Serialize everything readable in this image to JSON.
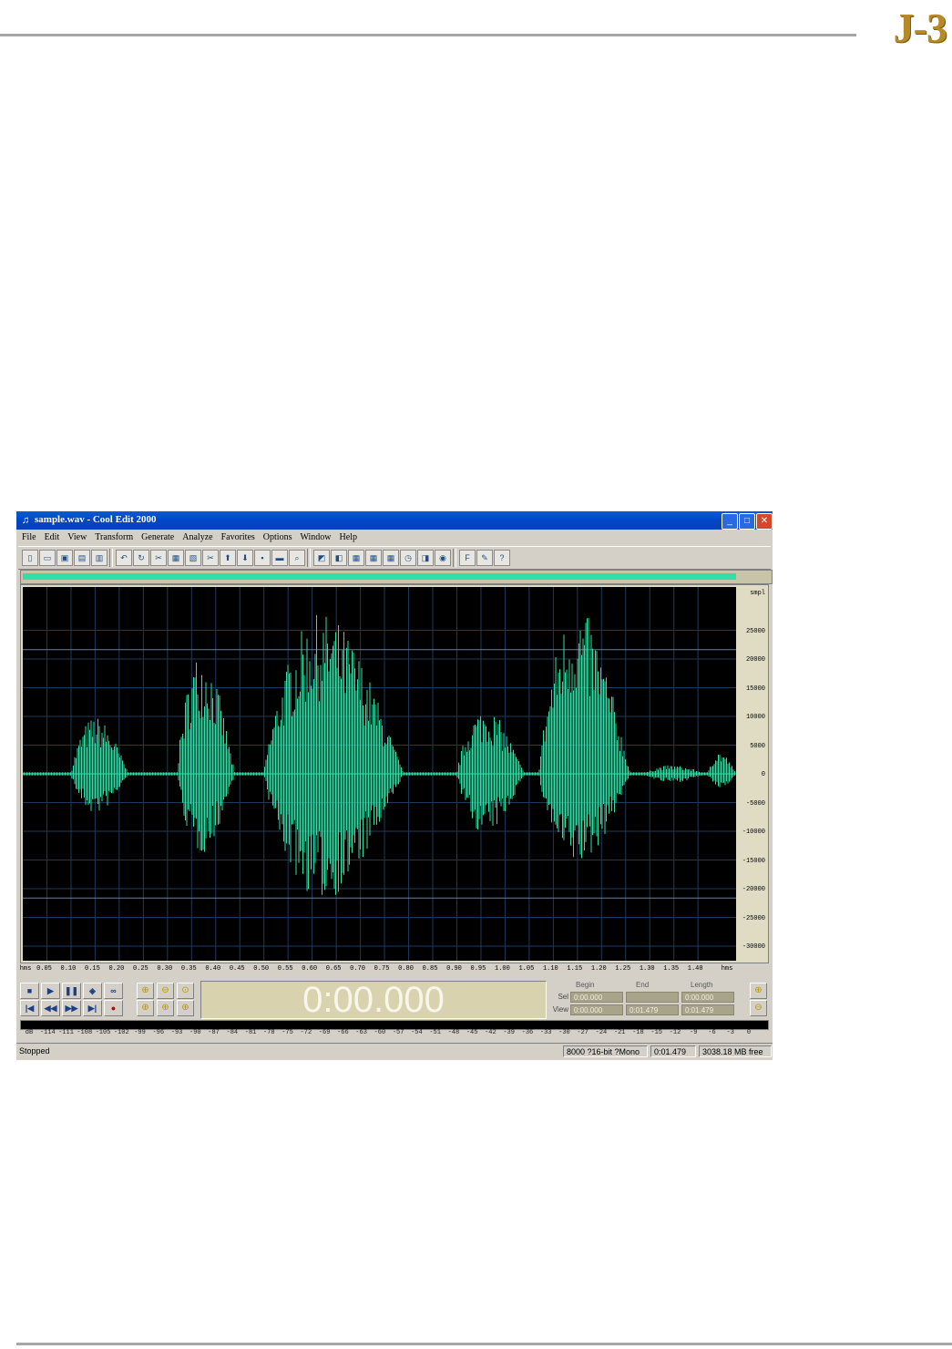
{
  "logo": "J-3",
  "window": {
    "title": "sample.wav - Cool Edit 2000",
    "controls": {
      "minimize": "_",
      "maximize": "□",
      "close": "✕"
    }
  },
  "menu": [
    "File",
    "Edit",
    "View",
    "Transform",
    "Generate",
    "Analyze",
    "Favorites",
    "Options",
    "Window",
    "Help"
  ],
  "toolbar": {
    "groups": [
      [
        "new-file-icon",
        "open-file-icon",
        "save-icon",
        "save-all-icon",
        "close-file-icon"
      ],
      [
        "undo-icon",
        "repeat-icon",
        "cut-mark-icon",
        "copy-icon",
        "paste-icon",
        "trim-icon",
        "mix-paste-icon",
        "insert-cue-icon",
        "save-selection-icon",
        "sample-icon",
        "find-icon"
      ],
      [
        "spectral-view-icon",
        "envelope-icon",
        "grid-icon",
        "grid2-icon",
        "grid3-icon",
        "info-icon",
        "doc-icon",
        "cd-icon"
      ],
      [
        "favorites-icon",
        "script-icon",
        "help-icon"
      ]
    ],
    "glyphs": [
      "▯",
      "▭",
      "▣",
      "▤",
      "▥",
      "↶",
      "↻",
      "✂",
      "▦",
      "▧",
      "✂",
      "⬆",
      "⬇",
      "▪",
      "▬",
      "⌕",
      "◩",
      "◧",
      "▦",
      "▦",
      "▦",
      "◷",
      "◨",
      "◉",
      "F",
      "✎",
      "?"
    ]
  },
  "waveform": {
    "amplitude_unit": "smpl",
    "amplitude_ticks": [
      "25000",
      "20000",
      "15000",
      "10000",
      "5000",
      "0",
      "-5000",
      "-10000",
      "-15000",
      "-20000",
      "-25000",
      "-30000"
    ],
    "time_unit": "hms",
    "time_ticks": [
      "0.05",
      "0.10",
      "0.15",
      "0.20",
      "0.25",
      "0.30",
      "0.35",
      "0.40",
      "0.45",
      "0.50",
      "0.55",
      "0.60",
      "0.65",
      "0.70",
      "0.75",
      "0.80",
      "0.85",
      "0.90",
      "0.95",
      "1.00",
      "1.05",
      "1.10",
      "1.15",
      "1.20",
      "1.25",
      "1.30",
      "1.35",
      "1.40"
    ],
    "duration_seconds": 1.479,
    "wave_color": "#2fe0a6",
    "bursts": [
      {
        "start": 0.1,
        "end": 0.22,
        "peak": 10000,
        "trough": -7000
      },
      {
        "start": 0.32,
        "end": 0.44,
        "peak": 21500,
        "trough": -14000
      },
      {
        "start": 0.5,
        "end": 0.79,
        "peak": 28000,
        "trough": -22000
      },
      {
        "start": 0.9,
        "end": 1.04,
        "peak": 11500,
        "trough": -10500
      },
      {
        "start": 1.07,
        "end": 1.26,
        "peak": 29000,
        "trough": -16000
      },
      {
        "start": 1.29,
        "end": 1.42,
        "peak": 1500,
        "trough": -1500
      },
      {
        "start": 1.42,
        "end": 1.479,
        "peak": 4000,
        "trough": -2500
      }
    ]
  },
  "transport": {
    "buttons": [
      {
        "name": "stop-button",
        "glyph": "■"
      },
      {
        "name": "play-button",
        "glyph": "▶"
      },
      {
        "name": "pause-button",
        "glyph": "❚❚"
      },
      {
        "name": "play-to-end-button",
        "glyph": "◈"
      },
      {
        "name": "loop-button",
        "glyph": "∞"
      },
      {
        "name": "go-to-start-button",
        "glyph": "|◀"
      },
      {
        "name": "rewind-button",
        "glyph": "◀◀"
      },
      {
        "name": "fast-forward-button",
        "glyph": "▶▶"
      },
      {
        "name": "go-to-end-button",
        "glyph": "▶|"
      },
      {
        "name": "record-button",
        "glyph": "●"
      }
    ],
    "zoom_buttons": [
      {
        "name": "zoom-in-horizontal-button",
        "glyph": "⊕"
      },
      {
        "name": "zoom-out-horizontal-button",
        "glyph": "⊖"
      },
      {
        "name": "zoom-full-button",
        "glyph": "⊙"
      },
      {
        "name": "zoom-left-button",
        "glyph": "⊕"
      },
      {
        "name": "zoom-right-button",
        "glyph": "⊕"
      },
      {
        "name": "zoom-selection-button",
        "glyph": "⊕"
      }
    ]
  },
  "time_display": "0:00.000",
  "selection": {
    "headers": {
      "begin": "Begin",
      "end": "End",
      "length": "Length"
    },
    "sel": {
      "label": "Sel",
      "begin": "0:00.000",
      "end": "",
      "length": "0:00.000"
    },
    "view": {
      "label": "View",
      "begin": "0:00.000",
      "end": "0:01.479",
      "length": "0:01.479"
    }
  },
  "meter_scale": [
    "dB",
    "-114",
    "-111",
    "-108",
    "-105",
    "-102",
    "-99",
    "-96",
    "-93",
    "-90",
    "-87",
    "-84",
    "-81",
    "-78",
    "-75",
    "-72",
    "-69",
    "-66",
    "-63",
    "-60",
    "-57",
    "-54",
    "-51",
    "-48",
    "-45",
    "-42",
    "-39",
    "-36",
    "-33",
    "-30",
    "-27",
    "-24",
    "-21",
    "-18",
    "-15",
    "-12",
    "-9",
    "-6",
    "-3",
    "0"
  ],
  "status": {
    "state": "Stopped",
    "format": "8000 ?16-bit ?Mono",
    "length": "0:01.479",
    "free": "3038.18 MB free"
  }
}
